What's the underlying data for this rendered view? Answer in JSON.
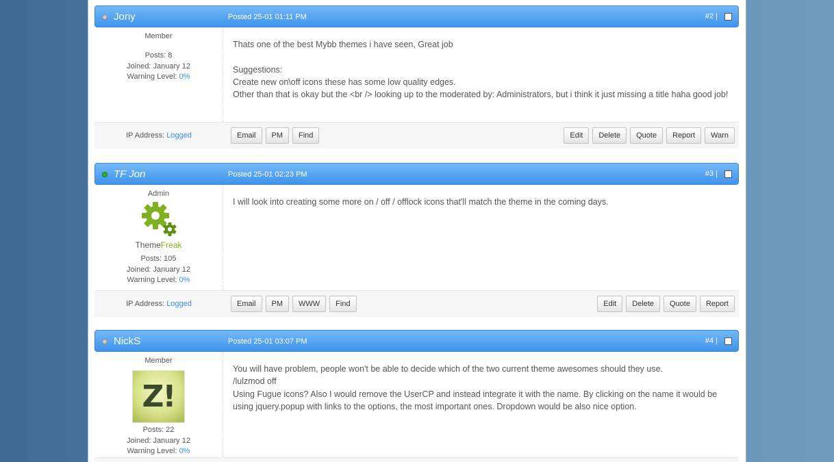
{
  "colors": {
    "header_blue": "#4a9cf0",
    "link_blue": "#3a8ee0",
    "brand_green": "#7fb11e"
  },
  "posts": [
    {
      "username": "Jony",
      "online": false,
      "date": "Posted 25-01 01:11 PM",
      "number": "#2 |",
      "role": "Member",
      "posts_label": "Posts: 8",
      "joined": "Joined: January 12",
      "warning_label": "Warning Level: ",
      "warning_value": "0%",
      "content": [
        "Thats one of the best Mybb themes i have seen, Great job",
        "",
        "Suggestions:",
        "Create new on\\off icons these has some low quality edges.",
        "Other than that is okay but the <br /> looking up to the moderated by: Administrators, but i think it just missing a title haha good job!"
      ],
      "ip_label": "IP Address: ",
      "ip_value": "Logged",
      "left_buttons": [
        "Email",
        "PM",
        "Find"
      ],
      "right_buttons": [
        "Edit",
        "Delete",
        "Quote",
        "Report",
        "Warn"
      ]
    },
    {
      "username": "TF Jon",
      "online": true,
      "date": "Posted 25-01 02:23 PM",
      "number": "#3 |",
      "role": "Admin",
      "brand_a": "Theme",
      "brand_b": "Freak",
      "posts_label": "Posts: 105",
      "joined": "Joined: January 12",
      "warning_label": "Warning Level: ",
      "warning_value": "0%",
      "content": [
        "I will look into creating some more on / off / offlock icons that'll match the theme in the coming days."
      ],
      "ip_label": "IP Address: ",
      "ip_value": "Logged",
      "left_buttons": [
        "Email",
        "PM",
        "WWW",
        "Find"
      ],
      "right_buttons": [
        "Edit",
        "Delete",
        "Quote",
        "Report"
      ]
    },
    {
      "username": "NickS",
      "online": false,
      "date": "Posted 25-01 03:07 PM",
      "number": "#4 |",
      "role": "Member",
      "avatar_text": "Z!",
      "posts_label": "Posts: 22",
      "joined": "Joined: January 12",
      "warning_label": "Warning Level: ",
      "warning_value": "0%",
      "content": [
        "You will have problem, people won't be able to decide which of the two current theme awesomes should they use.",
        "/lulzmod off",
        "Using Fugue icons? Also I would remove the UserCP and instead integrate it with the name. By clicking on the name it would be using jquery.popup with links to the options, the most important ones. Dropdown would be also nice option."
      ]
    }
  ]
}
